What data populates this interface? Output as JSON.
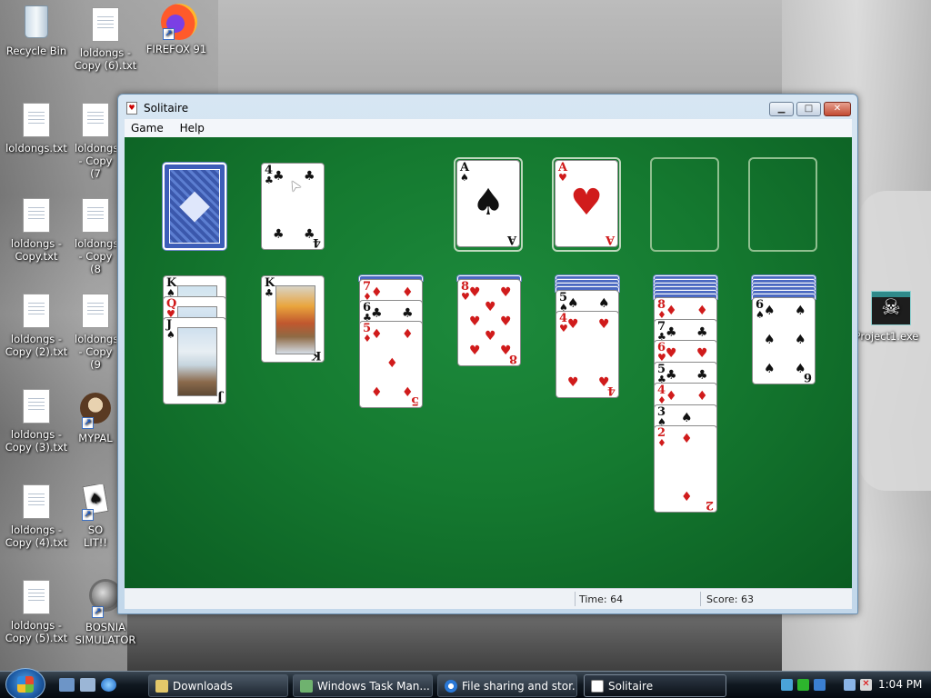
{
  "desktop": {
    "icons": [
      {
        "label": "Recycle Bin"
      },
      {
        "label": "loldongs - Copy (6).txt"
      },
      {
        "label": "FIREFOX 91"
      },
      {
        "label": "loldongs.txt"
      },
      {
        "label": "loldongs - Copy (7"
      },
      {
        "label": "loldongs - Copy.txt"
      },
      {
        "label": "loldongs - Copy (8"
      },
      {
        "label": "loldongs - Copy (2).txt"
      },
      {
        "label": "loldongs - Copy (9"
      },
      {
        "label": "loldongs - Copy (3).txt"
      },
      {
        "label": "MYPAL"
      },
      {
        "label": "loldongs - Copy (4).txt"
      },
      {
        "label": "SO LIT!!"
      },
      {
        "label": "loldongs - Copy (5).txt"
      },
      {
        "label": "BOSNIA SIMULATOR"
      },
      {
        "label": "Project1.exe"
      }
    ]
  },
  "window": {
    "title": "Solitaire",
    "menu": [
      "Game",
      "Help"
    ],
    "status": {
      "time": "Time:   64",
      "score": "Score: 63"
    }
  },
  "game": {
    "waste_top": {
      "rank": "4",
      "suit": "♣",
      "color": "#111111"
    },
    "foundations": [
      {
        "rank": "A",
        "suit": "♠",
        "color": "#111111"
      },
      {
        "rank": "A",
        "suit": "♥",
        "color": "#d01b1b"
      }
    ],
    "tableau": [
      {
        "faceup": [
          {
            "rank": "K",
            "suit": "♠"
          },
          {
            "rank": "Q",
            "suit": "♥"
          },
          {
            "rank": "J",
            "suit": "♠"
          }
        ]
      },
      {
        "faceup": [
          {
            "rank": "K",
            "suit": "♣"
          }
        ]
      },
      {
        "faceup": [
          {
            "rank": "7",
            "suit": "♦"
          },
          {
            "rank": "6",
            "suit": "♣"
          },
          {
            "rank": "5",
            "suit": "♦"
          }
        ]
      },
      {
        "faceup": [
          {
            "rank": "8",
            "suit": "♥"
          }
        ]
      },
      {
        "faceup": [
          {
            "rank": "5",
            "suit": "♠"
          },
          {
            "rank": "4",
            "suit": "♥"
          }
        ]
      },
      {
        "faceup": [
          {
            "rank": "8",
            "suit": "♦"
          },
          {
            "rank": "7",
            "suit": "♣"
          },
          {
            "rank": "6",
            "suit": "♥"
          },
          {
            "rank": "5",
            "suit": "♣"
          },
          {
            "rank": "4",
            "suit": "♦"
          },
          {
            "rank": "3",
            "suit": "♠"
          },
          {
            "rank": "2",
            "suit": "♦"
          }
        ]
      },
      {
        "faceup": [
          {
            "rank": "6",
            "suit": "♠"
          }
        ]
      }
    ]
  },
  "taskbar": {
    "buttons": [
      {
        "label": "Downloads"
      },
      {
        "label": "Windows Task Man..."
      },
      {
        "label": "File sharing and stor..."
      },
      {
        "label": "Solitaire"
      }
    ],
    "clock": "1:04 PM"
  }
}
